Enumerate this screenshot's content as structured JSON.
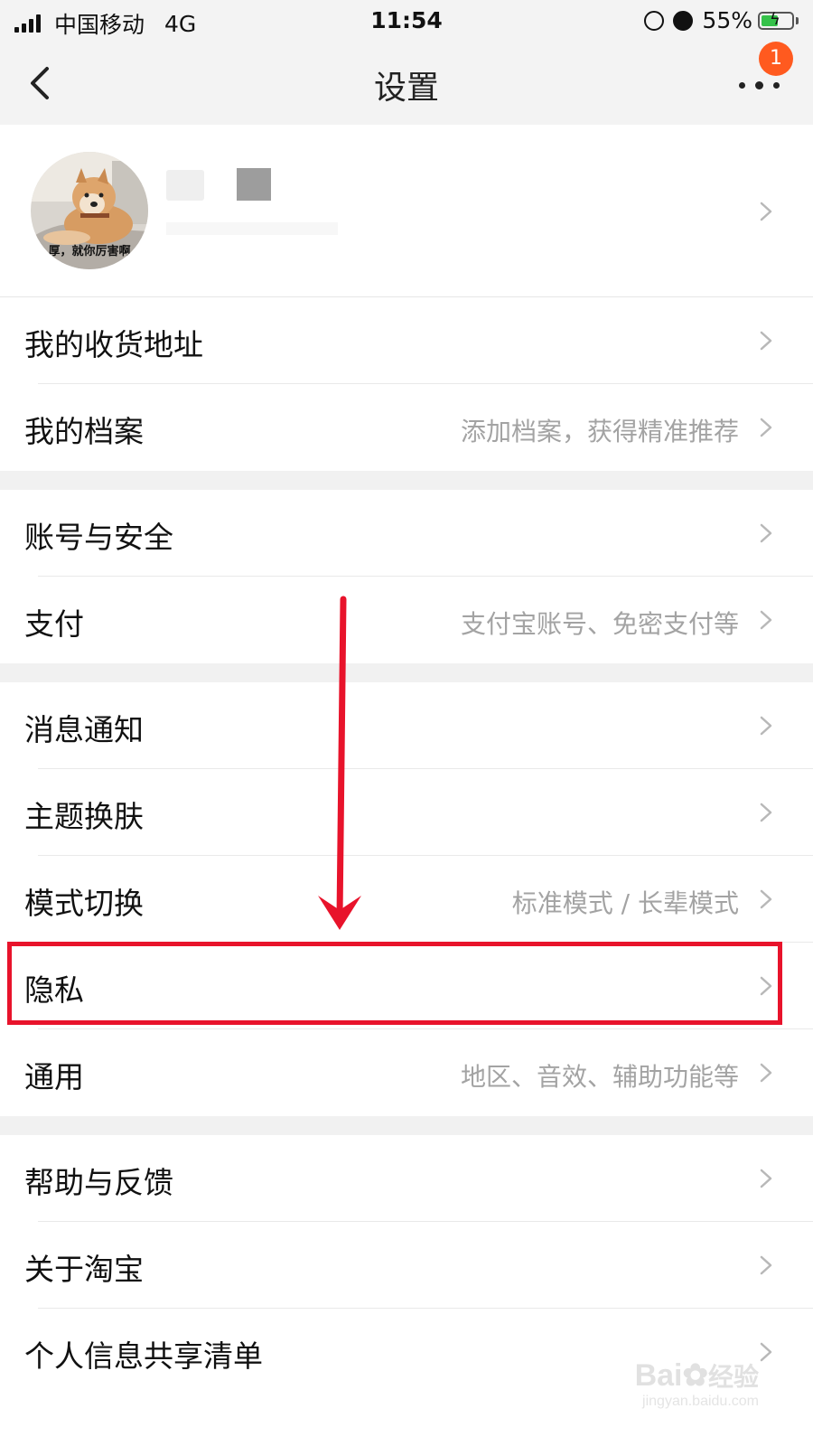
{
  "status_bar": {
    "carrier": "中国移动",
    "network": "4G",
    "time": "11:54",
    "battery_percent": "55%",
    "battery_level": 0.55,
    "icons": [
      "signal-icon",
      "orientation-lock-icon",
      "alarm-icon",
      "battery-charging-icon"
    ]
  },
  "nav": {
    "title": "设置",
    "back_icon": "chevron-left-icon",
    "more_icon": "more-dots-icon",
    "badge_count": "1"
  },
  "profile": {
    "avatar_caption": "厚，就你厉害啊"
  },
  "sections": [
    {
      "items": [
        {
          "label": "我的收货地址",
          "hint": ""
        },
        {
          "label": "我的档案",
          "hint": "添加档案，获得精准推荐"
        }
      ]
    },
    {
      "items": [
        {
          "label": "账号与安全",
          "hint": ""
        },
        {
          "label": "支付",
          "hint": "支付宝账号、免密支付等"
        }
      ]
    },
    {
      "items": [
        {
          "label": "消息通知",
          "hint": ""
        },
        {
          "label": "主题换肤",
          "hint": ""
        },
        {
          "label": "模式切换",
          "hint": "标准模式 / 长辈模式"
        },
        {
          "label": "隐私",
          "hint": ""
        },
        {
          "label": "通用",
          "hint": "地区、音效、辅助功能等"
        }
      ]
    },
    {
      "items": [
        {
          "label": "帮助与反馈",
          "hint": ""
        },
        {
          "label": "关于淘宝",
          "hint": ""
        },
        {
          "label": "个人信息共享清单",
          "hint": ""
        }
      ]
    }
  ],
  "watermark": {
    "brand": "Bai",
    "brand_suffix": "经验",
    "url": "jingyan.baidu.com"
  },
  "colors": {
    "annotation_red": "#e8132b",
    "badge_orange": "#ff5a1f",
    "hint_gray": "#a3a3a3",
    "background": "#f1f1f1"
  }
}
